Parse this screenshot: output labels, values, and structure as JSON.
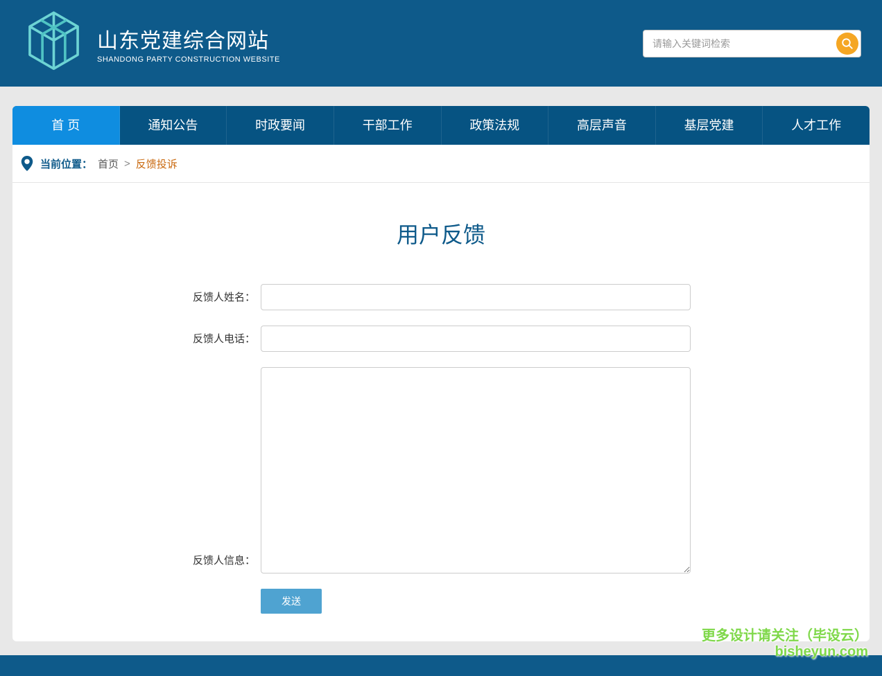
{
  "header": {
    "title_main": "山东党建综合网站",
    "title_sub": "SHANDONG PARTY CONSTRUCTION WEBSITE",
    "search_placeholder": "请输入关键词检索"
  },
  "nav": {
    "items": [
      {
        "label": "首 页",
        "active": true
      },
      {
        "label": "通知公告",
        "active": false
      },
      {
        "label": "时政要闻",
        "active": false
      },
      {
        "label": "干部工作",
        "active": false
      },
      {
        "label": "政策法规",
        "active": false
      },
      {
        "label": "高层声音",
        "active": false
      },
      {
        "label": "基层党建",
        "active": false
      },
      {
        "label": "人才工作",
        "active": false
      }
    ]
  },
  "breadcrumb": {
    "label": "当前位置：",
    "home": "首页",
    "sep": ">",
    "current": "反馈投诉"
  },
  "page": {
    "title": "用户反馈"
  },
  "form": {
    "name_label": "反馈人姓名：",
    "phone_label": "反馈人电话：",
    "info_label": "反馈人信息：",
    "submit_label": "发送"
  },
  "watermark": {
    "line1": "更多设计请关注（毕设云）",
    "line2": "bisheyun.com"
  }
}
